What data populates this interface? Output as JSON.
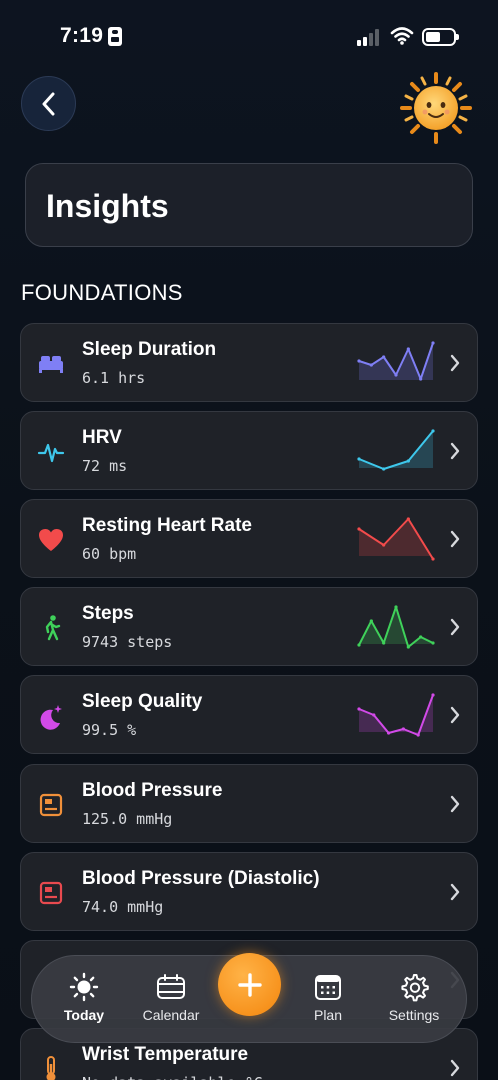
{
  "status_bar": {
    "time": "7:19"
  },
  "header": {
    "title": "Insights"
  },
  "section": {
    "heading": "FOUNDATIONS"
  },
  "metrics": [
    {
      "name": "Sleep Duration",
      "value": "6.1  hrs",
      "color": "#7f7ff5",
      "icon": "bed-icon",
      "spark": [
        0.55,
        0.45,
        0.65,
        0.2,
        0.85,
        0.1,
        1.0
      ]
    },
    {
      "name": "HRV",
      "value": "72  ms",
      "color": "#3ec8ec",
      "icon": "heartbeat-icon",
      "spark": [
        0.3,
        0.05,
        0.25,
        1.0
      ]
    },
    {
      "name": "Resting Heart Rate",
      "value": "60  bpm",
      "color": "#f24b4b",
      "icon": "heart-icon",
      "spark": [
        0.75,
        0.35,
        1.0,
        0.0
      ]
    },
    {
      "name": "Steps",
      "value": "9743  steps",
      "color": "#3fd15a",
      "icon": "walking-figure-icon",
      "spark": [
        0.05,
        0.65,
        0.1,
        1.0,
        0.0,
        0.25,
        0.1
      ]
    },
    {
      "name": "Sleep Quality",
      "value": "99.5  %",
      "color": "#d24ae8",
      "icon": "moon-stars-icon",
      "spark": [
        0.65,
        0.5,
        0.05,
        0.15,
        0.0,
        1.0
      ]
    },
    {
      "name": "Blood Pressure",
      "value": "125.0  mmHg",
      "color": "#f0903a",
      "icon": "monitor-icon",
      "spark": []
    },
    {
      "name": "Blood Pressure (Diastolic)",
      "value": "74.0  mmHg",
      "color": "#e84a4f",
      "icon": "monitor-icon",
      "spark": []
    },
    {
      "name": "",
      "value": "",
      "color": "#9aa0a8",
      "icon": "",
      "spark": []
    },
    {
      "name": "Wrist Temperature",
      "value": "No data available  °C",
      "color": "#f0903a",
      "icon": "thermometer-icon",
      "spark": []
    }
  ],
  "tab_bar": {
    "tabs": [
      {
        "label": "Today",
        "icon": "sun-icon",
        "active": true
      },
      {
        "label": "Calendar",
        "icon": "calendar-icon",
        "active": false
      },
      {
        "label": "Plan",
        "icon": "planner-icon",
        "active": false
      },
      {
        "label": "Settings",
        "icon": "gear-icon",
        "active": false
      }
    ],
    "add_label": "+"
  }
}
